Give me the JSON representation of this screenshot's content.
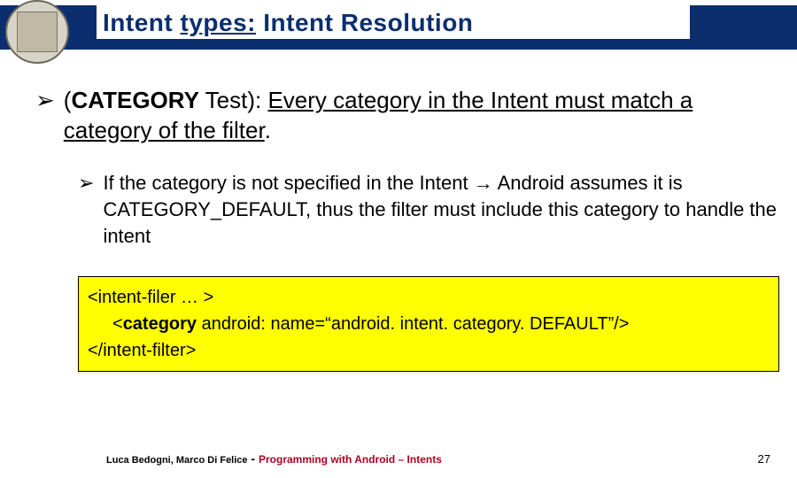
{
  "header": {
    "title_part1": "Intent ",
    "title_part2_underlined": "types:",
    "title_part3": " Intent Resolution"
  },
  "bullet1": {
    "marker": "➢",
    "cat_open": "(",
    "cat_strong": "CATEGORY",
    "cat_rest": " Test):  ",
    "underlined": "Every category in the Intent must match a category of the filter",
    "period": "."
  },
  "bullet2": {
    "marker": "➢",
    "pre": "If  the category is not specified in the Intent ",
    "arrow": "→",
    "post": " Android assumes it is CATEGORY_DEFAULT, thus the filter must include this category to handle the intent"
  },
  "code": {
    "line1": "<intent-filer … >",
    "line2_open": "<",
    "line2_tag": "category",
    "line2_rest": " android: name=“android. intent. category. DEFAULT”/>",
    "line3": "</intent-filter>"
  },
  "footer": {
    "authors": "Luca Bedogni, Marco Di Felice",
    "dash": " - ",
    "course": " Programming with Android – Intents",
    "page": "27"
  }
}
